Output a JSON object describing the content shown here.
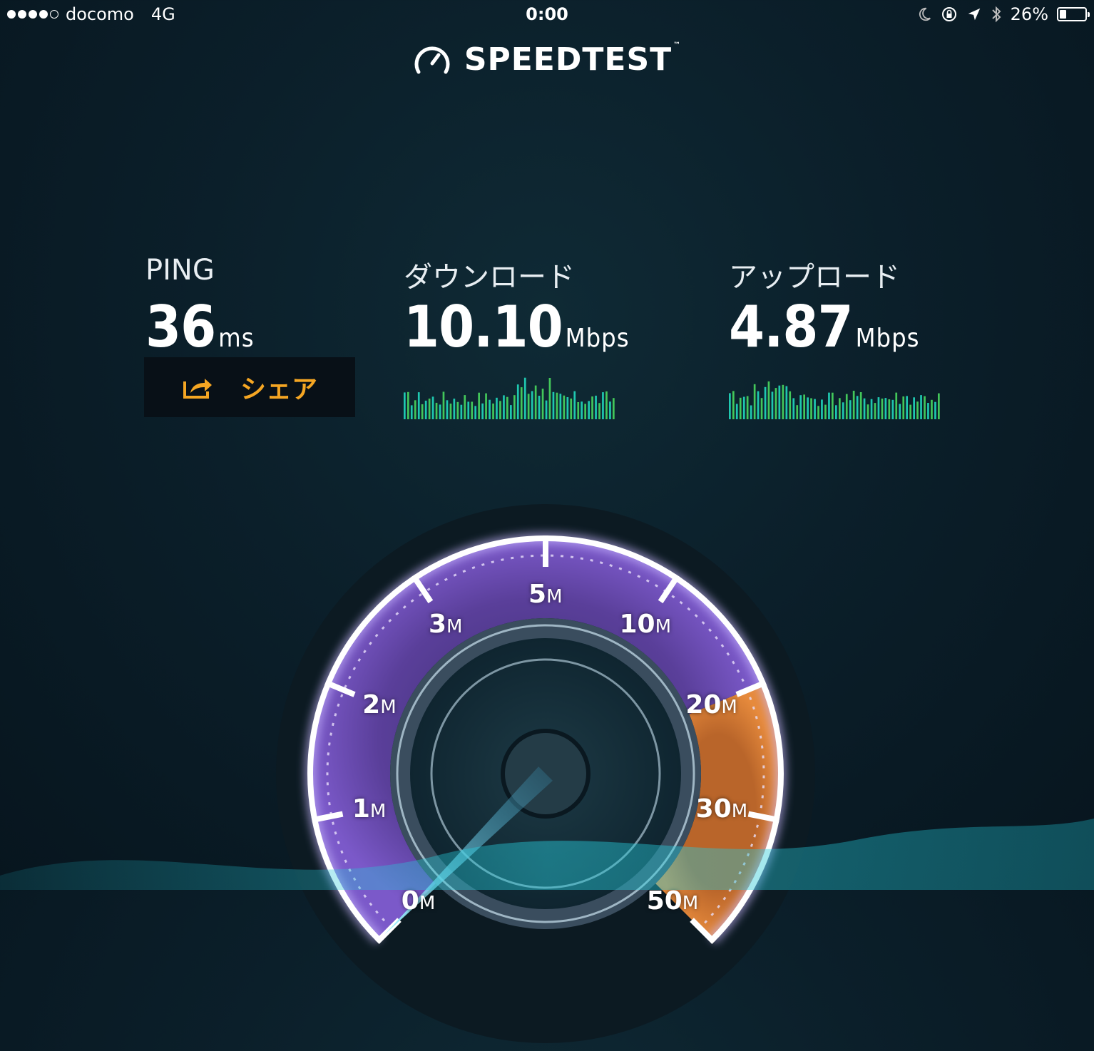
{
  "status_bar": {
    "carrier": "docomo",
    "network": "4G",
    "time": "0:00",
    "battery": "26%",
    "battery_level": 0.26,
    "signal_bars": 4,
    "signal_total": 5
  },
  "app": {
    "logo_text": "SPEEDTEST",
    "logo_tm": "™"
  },
  "ping": {
    "label": "PING",
    "value": "36",
    "unit": "ms"
  },
  "download": {
    "label": "ダウンロード",
    "value": "10.10",
    "unit": "Mbps"
  },
  "upload": {
    "label": "アップロード",
    "value": "4.87",
    "unit": "Mbps"
  },
  "share": {
    "label": "シェア"
  },
  "gauge": {
    "ticks": [
      {
        "num": "0",
        "unit": "M"
      },
      {
        "num": "1",
        "unit": "M"
      },
      {
        "num": "2",
        "unit": "M"
      },
      {
        "num": "3",
        "unit": "M"
      },
      {
        "num": "5",
        "unit": "M"
      },
      {
        "num": "10",
        "unit": "M"
      },
      {
        "num": "20",
        "unit": "M"
      },
      {
        "num": "30",
        "unit": "M"
      },
      {
        "num": "50",
        "unit": "M"
      }
    ],
    "needle_value": 0
  },
  "colors": {
    "accent": "#f5a623",
    "gauge_purple": "#5a3f9a",
    "gauge_orange": "#e07a2c",
    "spark_green": "#43c75a",
    "spark_teal": "#1fc7b0"
  }
}
